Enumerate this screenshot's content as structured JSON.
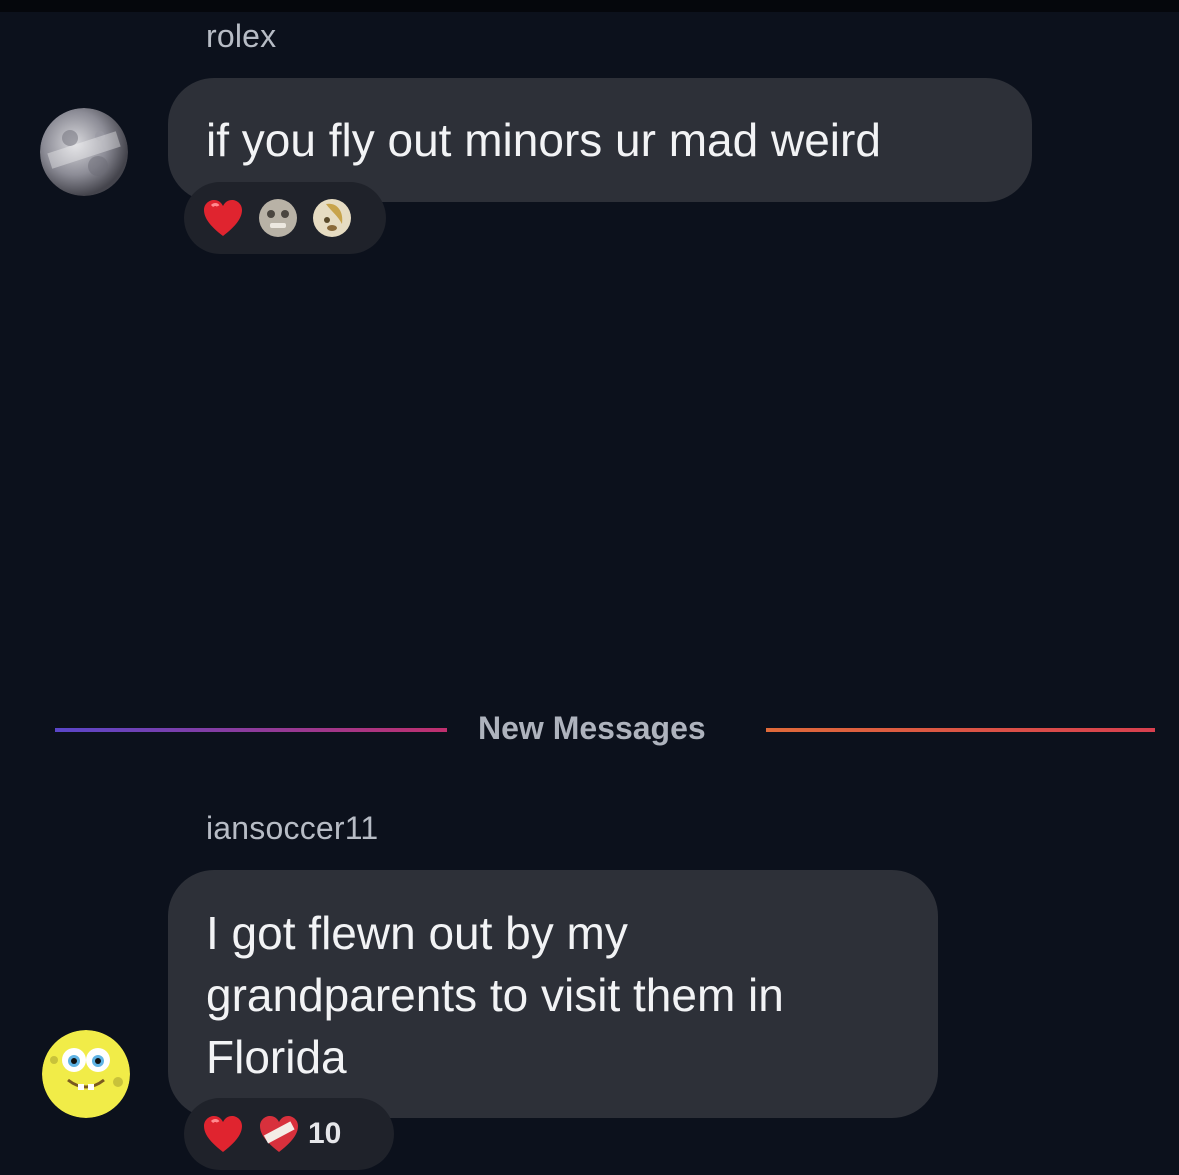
{
  "messages": [
    {
      "username": "rolex",
      "text": "if you fly out minors ur mad weird",
      "avatar_icon": "moon-avatar-icon",
      "reactions": [
        {
          "icon": "red-heart-icon"
        },
        {
          "icon": "face-emoji-icon"
        },
        {
          "icon": "face-emoji-icon"
        }
      ]
    },
    {
      "username": "iansoccer11",
      "text_lines": [
        "I got flewn out by my",
        "grandparents to visit them in",
        "Florida"
      ],
      "avatar_icon": "spongebob-avatar-icon",
      "reactions": [
        {
          "icon": "red-heart-icon"
        },
        {
          "icon": "bandaged-heart-icon",
          "count": "10"
        }
      ]
    }
  ],
  "divider": {
    "label": "New Messages",
    "colors": [
      "#5a46c9",
      "#c0306e",
      "#e06a3a",
      "#d8404f"
    ]
  },
  "colors": {
    "background": "#0c111c",
    "bubble": "#2d3038",
    "text": "#f2f3f5",
    "username": "#b7bcc5"
  }
}
